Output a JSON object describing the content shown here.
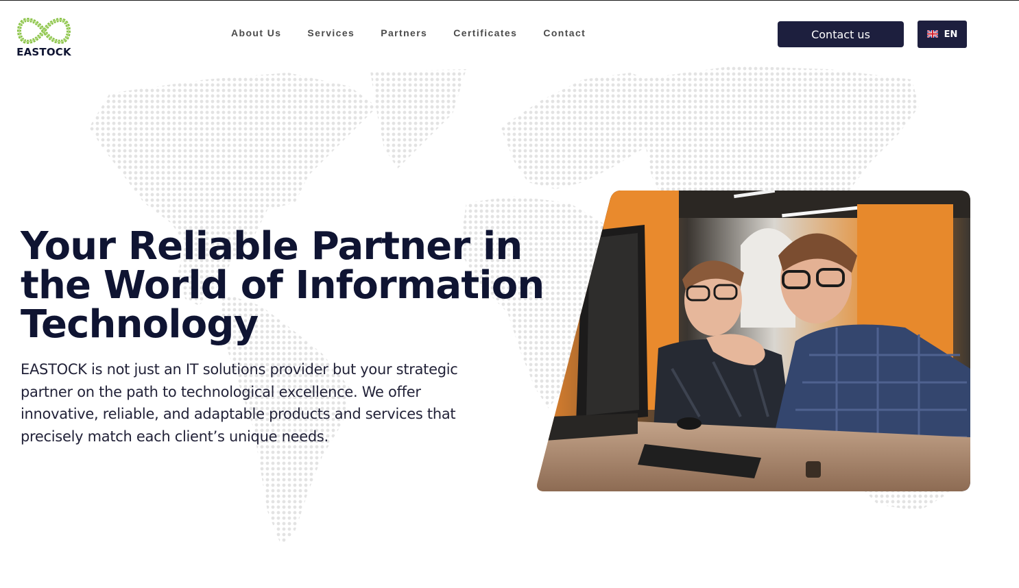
{
  "brand": {
    "name": "EASTOCK",
    "accent_color": "#8bc34a",
    "dark_color": "#1d1f3e",
    "logo_icon": "infinity-icon"
  },
  "nav": {
    "items": [
      {
        "label": "About Us"
      },
      {
        "label": "Services"
      },
      {
        "label": "Partners"
      },
      {
        "label": "Certificates"
      },
      {
        "label": "Contact"
      }
    ]
  },
  "header": {
    "contact_label": "Contact us",
    "language": {
      "code": "EN",
      "flag_icon": "uk-flag-icon"
    }
  },
  "hero": {
    "title": "Your Reliable Partner in the World of Information Technology",
    "description": "EASTOCK is not just an IT solutions provider but your strategic partner on the path to technological excellence. We offer innovative, reliable, and adaptable products and services that precisely match each client’s unique needs.",
    "image_icon": "office-team-photo"
  }
}
